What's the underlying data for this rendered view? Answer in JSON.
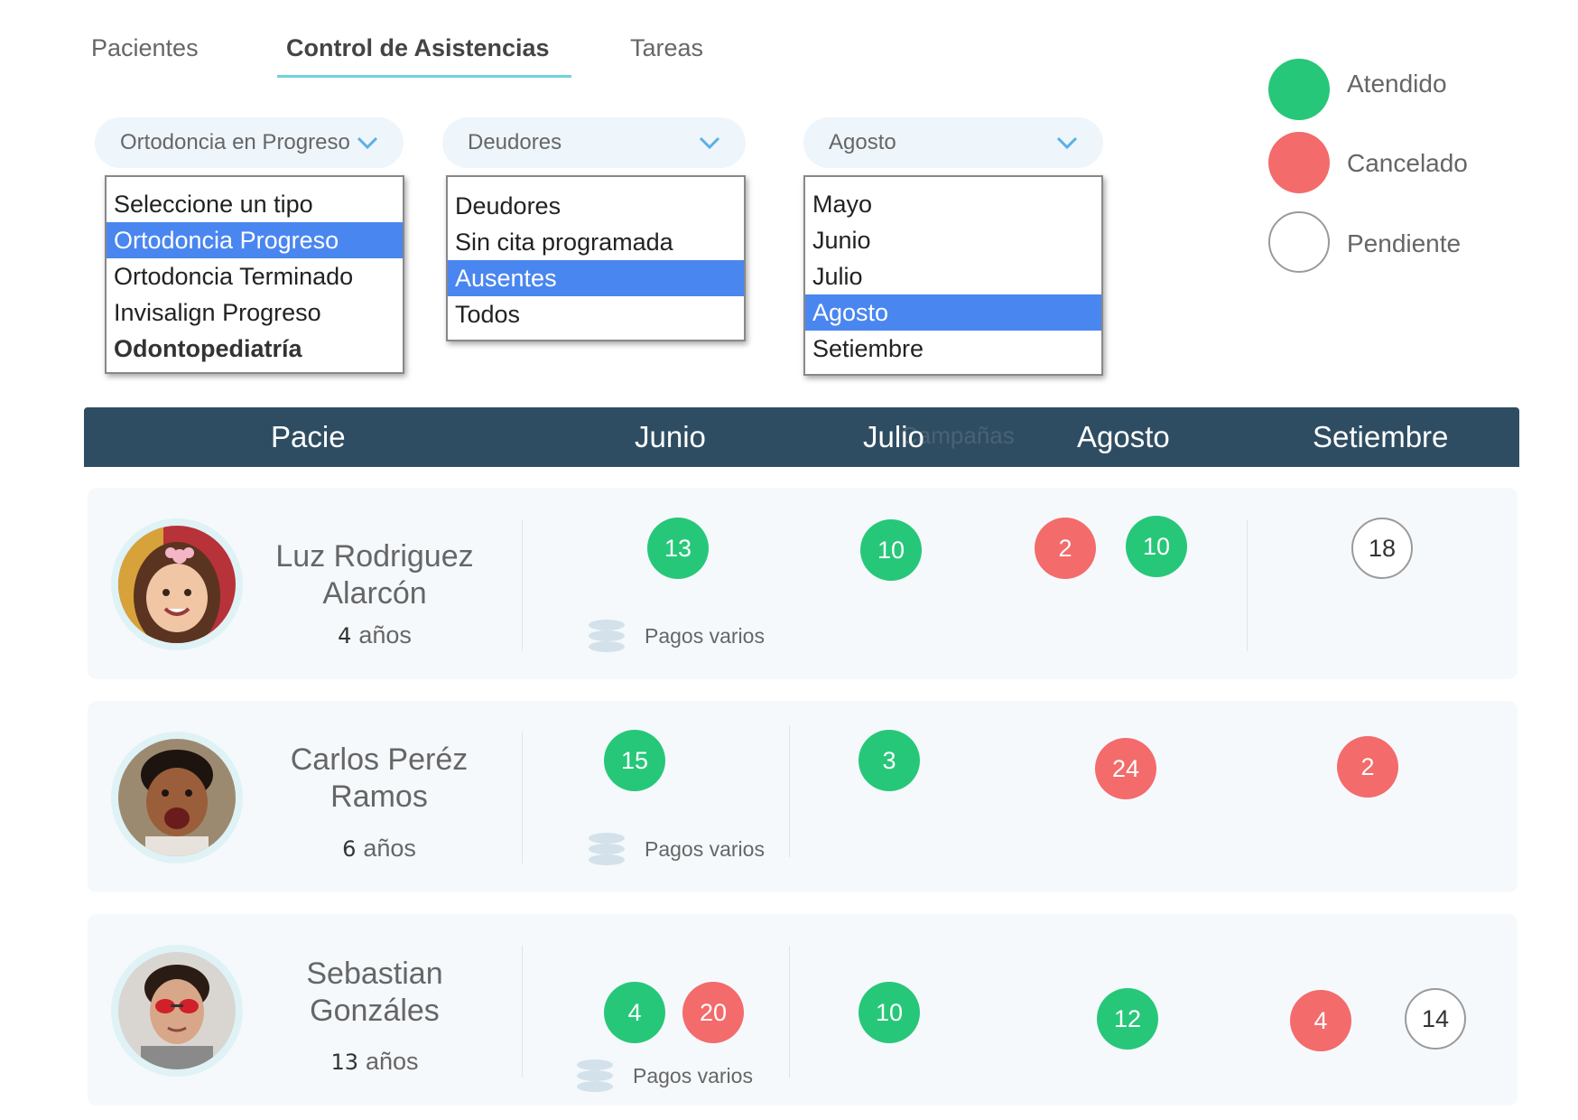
{
  "tabs": [
    {
      "label": "Pacientes"
    },
    {
      "label": "Control de Asistencias"
    },
    {
      "label": "Tareas"
    }
  ],
  "filters": {
    "tipo": {
      "selected": "Ortodoncia en Progreso",
      "options": [
        "Seleccione un tipo",
        "Ortodoncia Progreso",
        "Ortodoncia Terminado",
        "Invisalign Progreso",
        "Odontopediatría"
      ],
      "highlighted": "Ortodoncia Progreso"
    },
    "estado": {
      "selected": "Deudores",
      "options": [
        "Deudores",
        "Sin cita programada",
        "Ausentes",
        "Todos"
      ],
      "highlighted": "Ausentes"
    },
    "mes": {
      "selected": "Agosto",
      "options": [
        "Mayo",
        "Junio",
        "Julio",
        "Agosto",
        "Setiembre"
      ],
      "highlighted": "Agosto"
    }
  },
  "legend": [
    {
      "label": "Atendido",
      "color": "#27c779"
    },
    {
      "label": "Cancelado",
      "color": "#f36b6b"
    },
    {
      "label": "Pendiente",
      "color": "#ffffff"
    }
  ],
  "table": {
    "headers": [
      "Pacie",
      "Junio",
      "Julio",
      "Agosto",
      "Setiembre"
    ],
    "ghost_text": "Campañas",
    "pagos_label": "Pagos varios",
    "age_unit": "años",
    "rows": [
      {
        "name_line1": "Luz Rodriguez",
        "name_line2": "Alarcón",
        "age": "4",
        "appointments": {
          "junio": [
            "13"
          ],
          "julio": [
            "10"
          ],
          "agosto": [
            "2",
            "10"
          ],
          "setiembre": [
            "18"
          ]
        }
      },
      {
        "name_line1": "Carlos Peréz",
        "name_line2": "Ramos",
        "age": "6",
        "appointments": {
          "junio": [
            "15"
          ],
          "julio": [
            "3"
          ],
          "agosto": [
            "24"
          ],
          "setiembre": [
            "2"
          ]
        }
      },
      {
        "name_line1": "Sebastian",
        "name_line2": "Gonzáles",
        "age": "13",
        "appointments": {
          "junio": [
            "4",
            "20"
          ],
          "julio": [
            "10"
          ],
          "agosto": [
            "12"
          ],
          "setiembre": [
            "4",
            "14"
          ]
        }
      }
    ]
  }
}
